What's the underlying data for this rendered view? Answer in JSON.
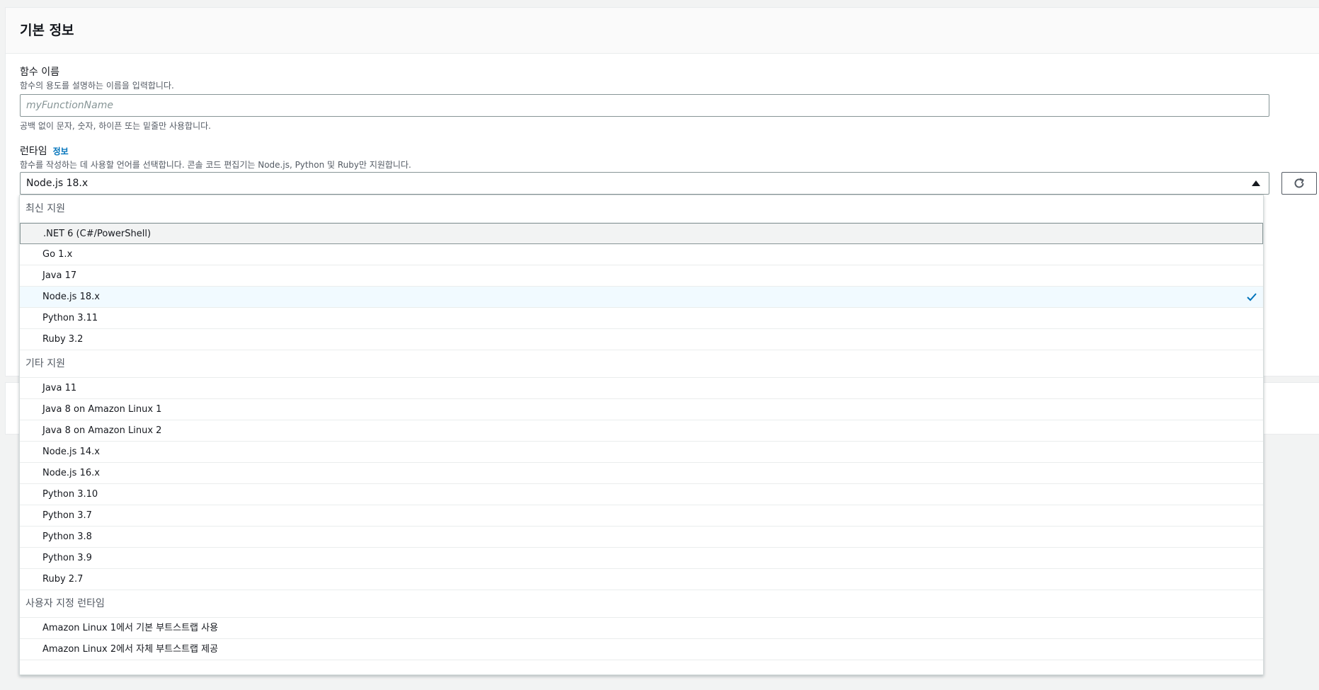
{
  "panel": {
    "title": "기본 정보"
  },
  "function_name": {
    "label": "함수 이름",
    "description": "함수의 용도를 설명하는 이름을 입력합니다.",
    "placeholder": "myFunctionName",
    "value": "",
    "hint": "공백 없이 문자, 숫자, 하이픈 또는 밑줄만 사용합니다."
  },
  "runtime": {
    "label": "런타임",
    "info_link": "정보",
    "description": "함수를 작성하는 데 사용할 언어를 선택합니다. 콘솔 코드 편집기는 Node.js, Python 및 Ruby만 지원합니다.",
    "selected": "Node.js 18.x",
    "groups": [
      {
        "label": "최신 지원",
        "options": [
          {
            "label": ".NET 6 (C#/PowerShell)",
            "state": "highlighted"
          },
          {
            "label": "Go 1.x",
            "state": ""
          },
          {
            "label": "Java 17",
            "state": ""
          },
          {
            "label": "Node.js 18.x",
            "state": "selected"
          },
          {
            "label": "Python 3.11",
            "state": ""
          },
          {
            "label": "Ruby 3.2",
            "state": ""
          }
        ]
      },
      {
        "label": "기타 지원",
        "options": [
          {
            "label": "Java 11",
            "state": ""
          },
          {
            "label": "Java 8 on Amazon Linux 1",
            "state": ""
          },
          {
            "label": "Java 8 on Amazon Linux 2",
            "state": ""
          },
          {
            "label": "Node.js 14.x",
            "state": ""
          },
          {
            "label": "Node.js 16.x",
            "state": ""
          },
          {
            "label": "Python 3.10",
            "state": ""
          },
          {
            "label": "Python 3.7",
            "state": ""
          },
          {
            "label": "Python 3.8",
            "state": ""
          },
          {
            "label": "Python 3.9",
            "state": ""
          },
          {
            "label": "Ruby 2.7",
            "state": ""
          }
        ]
      },
      {
        "label": "사용자 지정 런타임",
        "options": [
          {
            "label": "Amazon Linux 1에서 기본 부트스트랩 사용",
            "state": ""
          },
          {
            "label": "Amazon Linux 2에서 자체 부트스트랩 제공",
            "state": ""
          }
        ]
      }
    ]
  },
  "colors": {
    "accent": "#0073bb",
    "check": "#0073bb",
    "selected_bg": "#f1faff",
    "highlight_bg": "#f2f3f3"
  },
  "icons": {
    "refresh": "refresh-icon",
    "caret": "caret-up-icon",
    "check": "check-icon"
  }
}
